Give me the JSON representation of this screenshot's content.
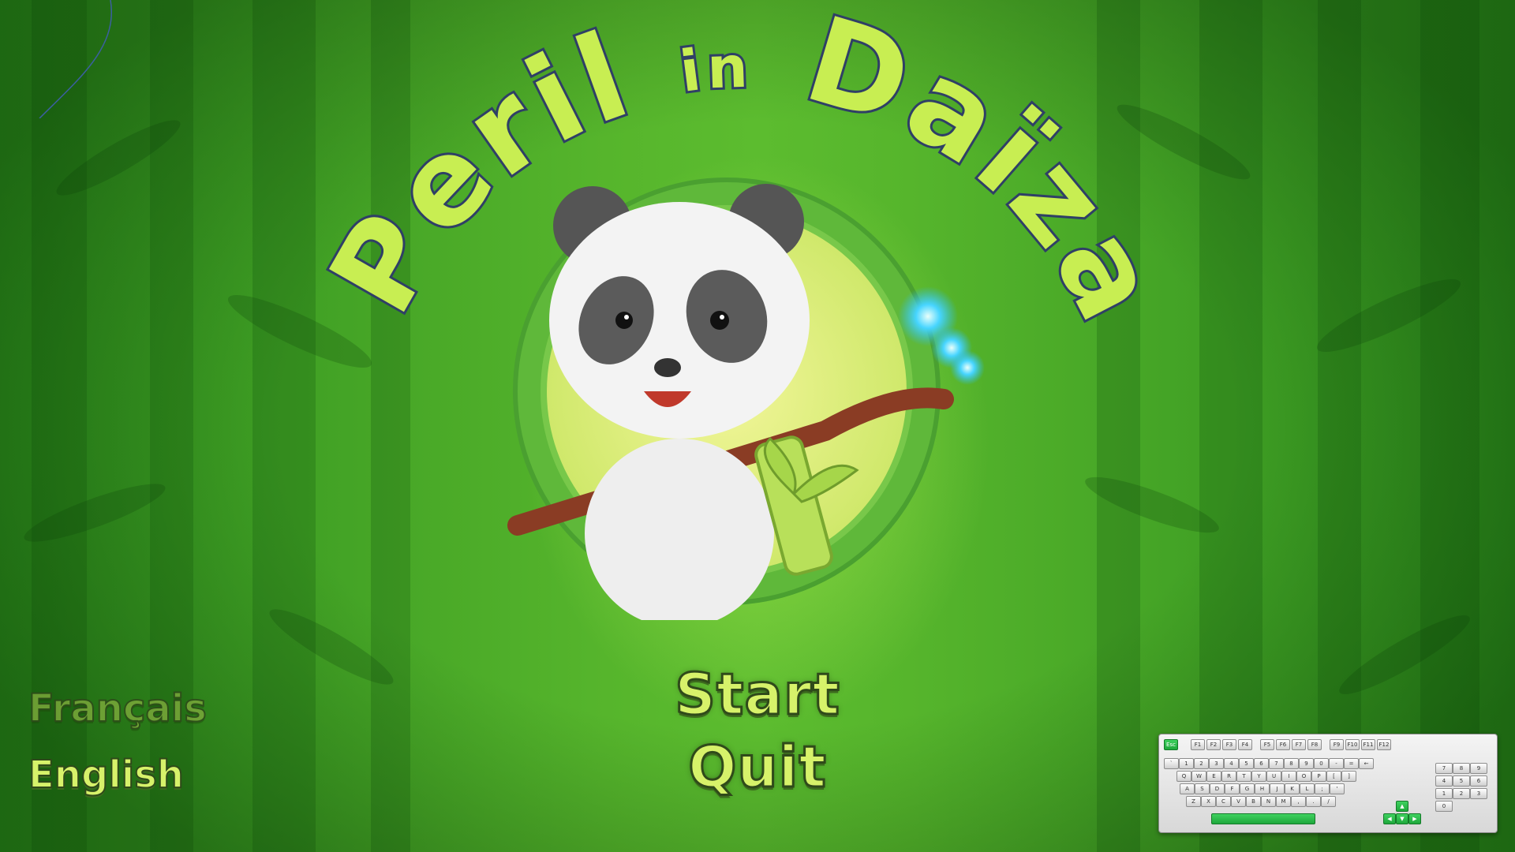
{
  "title": {
    "word1": "Peril",
    "word2": "in",
    "word3": "Daïza"
  },
  "menu": {
    "start": "Start",
    "quit": "Quit"
  },
  "languages": {
    "french": "Français",
    "english": "English",
    "selected": "English"
  },
  "keyboard": {
    "fn_row": [
      "Esc",
      "F1",
      "F2",
      "F3",
      "F4",
      "F5",
      "F6",
      "F7",
      "F8",
      "F9",
      "F10",
      "F11",
      "F12"
    ],
    "row1": [
      "`",
      "1",
      "2",
      "3",
      "4",
      "5",
      "6",
      "7",
      "8",
      "9",
      "0",
      "-",
      "=",
      "←"
    ],
    "row2": [
      "Q",
      "W",
      "E",
      "R",
      "T",
      "Y",
      "U",
      "I",
      "O",
      "P",
      "[",
      "]"
    ],
    "row3": [
      "A",
      "S",
      "D",
      "F",
      "G",
      "H",
      "J",
      "K",
      "L",
      ";",
      "'"
    ],
    "row4": [
      "Z",
      "X",
      "C",
      "V",
      "B",
      "N",
      "M",
      ",",
      ".",
      "/"
    ],
    "numpad": [
      "7",
      "8",
      "9",
      "4",
      "5",
      "6",
      "1",
      "2",
      "3",
      "0"
    ]
  },
  "colors": {
    "title_fill": "#c8ee52",
    "title_outline": "#2f3f66",
    "menu_text": "#d7f26a",
    "background": "#4aa82a",
    "keyboard_accent": "#22b845"
  }
}
